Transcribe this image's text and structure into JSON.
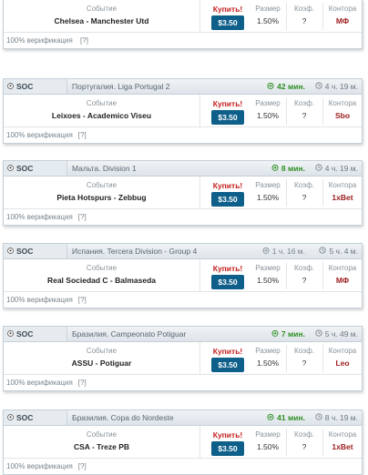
{
  "labels": {
    "event": "Событие",
    "buy": "Купить!",
    "size": "Размер",
    "coef": "Коэф.",
    "bookmaker": "Контора",
    "verification": "100% верификация",
    "help": "[?]"
  },
  "colors": {
    "accent_price_bg": "#0e5f8a",
    "buy_red": "#c41f1f",
    "bookmaker_red": "#9b1b1b",
    "time_green": "#2f8f24"
  },
  "cards": [
    {
      "has_header": false,
      "event": "Chelsea - Manchester Utd",
      "price": "$3.50",
      "size": "1.50%",
      "coef": "?",
      "bookmaker": "МФ"
    },
    {
      "has_header": true,
      "sport": "SOC",
      "league": "Португалия. Liga Portugal 2",
      "time1": "42 мин.",
      "time1_style": "green",
      "time2": "4 ч. 19 м.",
      "event": "Leixoes - Academico Viseu",
      "price": "$3.50",
      "size": "1.50%",
      "coef": "?",
      "bookmaker": "Sbo"
    },
    {
      "has_header": true,
      "sport": "SOC",
      "league": "Мальта. Division 1",
      "time1": "8 мин.",
      "time1_style": "green",
      "time2": "4 ч. 19 м.",
      "event": "Pieta Hotspurs - Zebbug",
      "price": "$3.50",
      "size": "1.50%",
      "coef": "?",
      "bookmaker": "1xBet"
    },
    {
      "has_header": true,
      "sport": "SOC",
      "league": "Испания. Tercera Division - Group 4",
      "time1": "1 ч. 16 м.",
      "time1_style": "grey",
      "time2": "5 ч. 4 м.",
      "event": "Real Sociedad C - Balmaseda",
      "price": "$3.50",
      "size": "1.50%",
      "coef": "?",
      "bookmaker": "МФ"
    },
    {
      "has_header": true,
      "sport": "SOC",
      "league": "Бразилия. Campeonato Potiguar",
      "time1": "7 мин.",
      "time1_style": "green",
      "time2": "5 ч. 49 м.",
      "event": "ASSU - Potiguar",
      "price": "$3.50",
      "size": "1.50%",
      "coef": "?",
      "bookmaker": "Leo"
    },
    {
      "has_header": true,
      "sport": "SOC",
      "league": "Бразилия. Copa do Nordeste",
      "time1": "41 мин.",
      "time1_style": "green",
      "time2": "8 ч. 19 м.",
      "event": "CSA - Treze PB",
      "price": "$3.50",
      "size": "1.50%",
      "coef": "?",
      "bookmaker": "1xBet"
    }
  ]
}
